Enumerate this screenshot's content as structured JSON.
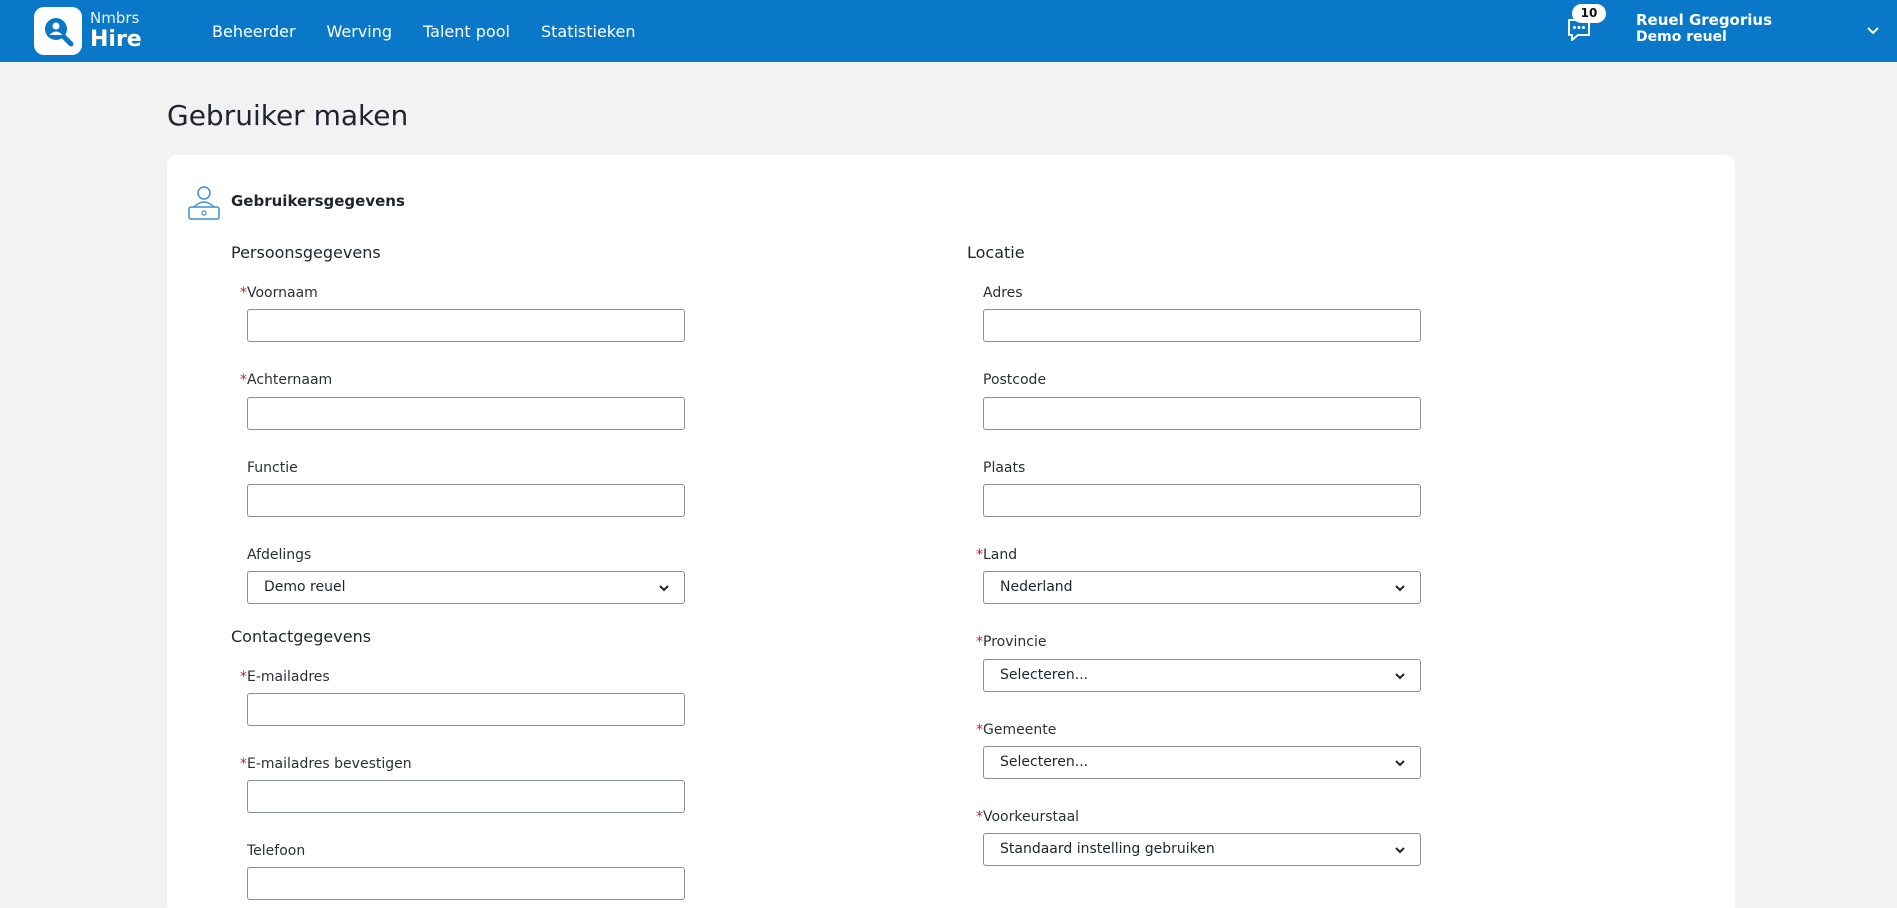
{
  "brand": {
    "small": "Nmbrs",
    "big": "Hire"
  },
  "nav": [
    "Beheerder",
    "Werving",
    "Talent pool",
    "Statistieken"
  ],
  "notifications": {
    "count": "10"
  },
  "user": {
    "name": "Reuel Gregorius",
    "org": "Demo reuel"
  },
  "page_title": "Gebruiker maken",
  "card_title": "Gebruikersgegevens",
  "sections": {
    "personal": "Persoonsgegevens",
    "contact": "Contactgegevens",
    "location": "Locatie"
  },
  "required_mark": "*",
  "fields": {
    "voornaam": "Voornaam",
    "achternaam": "Achternaam",
    "functie": "Functie",
    "afdelings": "Afdelings",
    "afdelings_value": "Demo reuel",
    "email": "E-mailadres",
    "email_confirm": "E-mailadres bevestigen",
    "telefoon": "Telefoon",
    "adres": "Adres",
    "postcode": "Postcode",
    "plaats": "Plaats",
    "land": "Land",
    "land_value": "Nederland",
    "provincie": "Provincie",
    "provincie_value": "Selecteren...",
    "gemeente": "Gemeente",
    "gemeente_value": "Selecteren...",
    "voorkeurstaal": "Voorkeurstaal",
    "voorkeurstaal_value": "Standaard instelling gebruiken"
  },
  "colors": {
    "header": "#0a78c8",
    "required": "#c0262d",
    "page_bg": "#f2f2f2"
  }
}
